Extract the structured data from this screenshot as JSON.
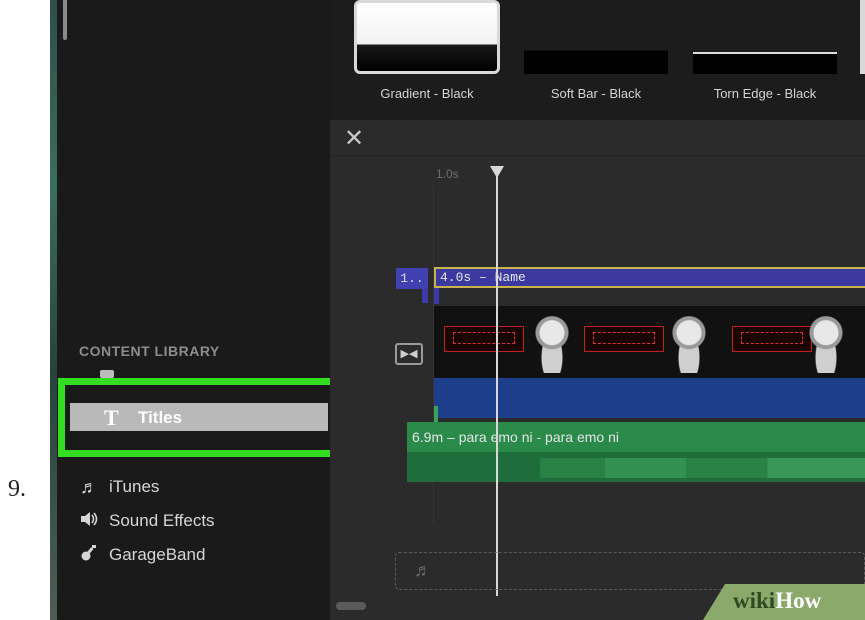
{
  "step_number": "9.",
  "content_library": {
    "heading": "CONTENT LIBRARY",
    "items": [
      {
        "label": "Titles",
        "icon": "T"
      },
      {
        "label": "iTunes",
        "icon": "♬"
      },
      {
        "label": "Sound Effects",
        "icon": "🔈"
      },
      {
        "label": "GarageBand",
        "icon": "guitar-icon"
      }
    ],
    "highlight_color": "#33dd22"
  },
  "title_styles": [
    {
      "caption": "Gradient - Black",
      "selected": true
    },
    {
      "caption": "Soft Bar - Black",
      "selected": false
    },
    {
      "caption": "Torn Edge - Black",
      "selected": false
    }
  ],
  "timeline": {
    "ruler_label": "1.0s",
    "small_clip_label": "1..",
    "title_clip_label": "4.0s – Name",
    "audio_clip_label": "6.9m – para emo ni - para emo ni"
  },
  "watermark": {
    "part1": "wiki",
    "part2": "How"
  }
}
